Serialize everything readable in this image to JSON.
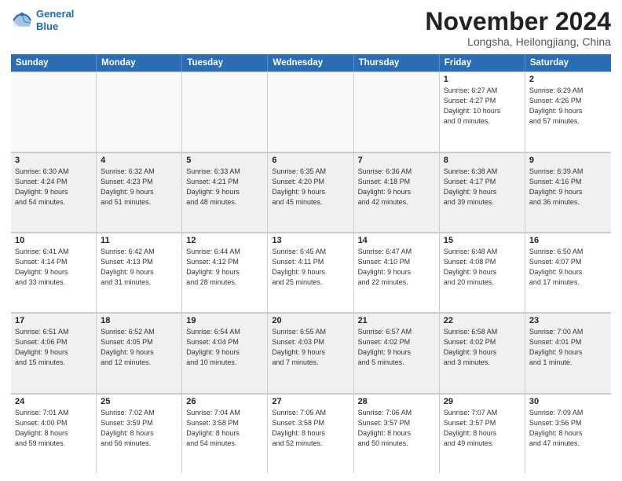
{
  "logo": {
    "line1": "General",
    "line2": "Blue"
  },
  "title": "November 2024",
  "subtitle": "Longsha, Heilongjiang, China",
  "header": {
    "days": [
      "Sunday",
      "Monday",
      "Tuesday",
      "Wednesday",
      "Thursday",
      "Friday",
      "Saturday"
    ]
  },
  "weeks": [
    [
      {
        "day": "",
        "info": ""
      },
      {
        "day": "",
        "info": ""
      },
      {
        "day": "",
        "info": ""
      },
      {
        "day": "",
        "info": ""
      },
      {
        "day": "",
        "info": ""
      },
      {
        "day": "1",
        "info": "Sunrise: 6:27 AM\nSunset: 4:27 PM\nDaylight: 10 hours\nand 0 minutes."
      },
      {
        "day": "2",
        "info": "Sunrise: 6:29 AM\nSunset: 4:26 PM\nDaylight: 9 hours\nand 57 minutes."
      }
    ],
    [
      {
        "day": "3",
        "info": "Sunrise: 6:30 AM\nSunset: 4:24 PM\nDaylight: 9 hours\nand 54 minutes."
      },
      {
        "day": "4",
        "info": "Sunrise: 6:32 AM\nSunset: 4:23 PM\nDaylight: 9 hours\nand 51 minutes."
      },
      {
        "day": "5",
        "info": "Sunrise: 6:33 AM\nSunset: 4:21 PM\nDaylight: 9 hours\nand 48 minutes."
      },
      {
        "day": "6",
        "info": "Sunrise: 6:35 AM\nSunset: 4:20 PM\nDaylight: 9 hours\nand 45 minutes."
      },
      {
        "day": "7",
        "info": "Sunrise: 6:36 AM\nSunset: 4:18 PM\nDaylight: 9 hours\nand 42 minutes."
      },
      {
        "day": "8",
        "info": "Sunrise: 6:38 AM\nSunset: 4:17 PM\nDaylight: 9 hours\nand 39 minutes."
      },
      {
        "day": "9",
        "info": "Sunrise: 6:39 AM\nSunset: 4:16 PM\nDaylight: 9 hours\nand 36 minutes."
      }
    ],
    [
      {
        "day": "10",
        "info": "Sunrise: 6:41 AM\nSunset: 4:14 PM\nDaylight: 9 hours\nand 33 minutes."
      },
      {
        "day": "11",
        "info": "Sunrise: 6:42 AM\nSunset: 4:13 PM\nDaylight: 9 hours\nand 31 minutes."
      },
      {
        "day": "12",
        "info": "Sunrise: 6:44 AM\nSunset: 4:12 PM\nDaylight: 9 hours\nand 28 minutes."
      },
      {
        "day": "13",
        "info": "Sunrise: 6:45 AM\nSunset: 4:11 PM\nDaylight: 9 hours\nand 25 minutes."
      },
      {
        "day": "14",
        "info": "Sunrise: 6:47 AM\nSunset: 4:10 PM\nDaylight: 9 hours\nand 22 minutes."
      },
      {
        "day": "15",
        "info": "Sunrise: 6:48 AM\nSunset: 4:08 PM\nDaylight: 9 hours\nand 20 minutes."
      },
      {
        "day": "16",
        "info": "Sunrise: 6:50 AM\nSunset: 4:07 PM\nDaylight: 9 hours\nand 17 minutes."
      }
    ],
    [
      {
        "day": "17",
        "info": "Sunrise: 6:51 AM\nSunset: 4:06 PM\nDaylight: 9 hours\nand 15 minutes."
      },
      {
        "day": "18",
        "info": "Sunrise: 6:52 AM\nSunset: 4:05 PM\nDaylight: 9 hours\nand 12 minutes."
      },
      {
        "day": "19",
        "info": "Sunrise: 6:54 AM\nSunset: 4:04 PM\nDaylight: 9 hours\nand 10 minutes."
      },
      {
        "day": "20",
        "info": "Sunrise: 6:55 AM\nSunset: 4:03 PM\nDaylight: 9 hours\nand 7 minutes."
      },
      {
        "day": "21",
        "info": "Sunrise: 6:57 AM\nSunset: 4:02 PM\nDaylight: 9 hours\nand 5 minutes."
      },
      {
        "day": "22",
        "info": "Sunrise: 6:58 AM\nSunset: 4:02 PM\nDaylight: 9 hours\nand 3 minutes."
      },
      {
        "day": "23",
        "info": "Sunrise: 7:00 AM\nSunset: 4:01 PM\nDaylight: 9 hours\nand 1 minute."
      }
    ],
    [
      {
        "day": "24",
        "info": "Sunrise: 7:01 AM\nSunset: 4:00 PM\nDaylight: 8 hours\nand 59 minutes."
      },
      {
        "day": "25",
        "info": "Sunrise: 7:02 AM\nSunset: 3:59 PM\nDaylight: 8 hours\nand 56 minutes."
      },
      {
        "day": "26",
        "info": "Sunrise: 7:04 AM\nSunset: 3:58 PM\nDaylight: 8 hours\nand 54 minutes."
      },
      {
        "day": "27",
        "info": "Sunrise: 7:05 AM\nSunset: 3:58 PM\nDaylight: 8 hours\nand 52 minutes."
      },
      {
        "day": "28",
        "info": "Sunrise: 7:06 AM\nSunset: 3:57 PM\nDaylight: 8 hours\nand 50 minutes."
      },
      {
        "day": "29",
        "info": "Sunrise: 7:07 AM\nSunset: 3:57 PM\nDaylight: 8 hours\nand 49 minutes."
      },
      {
        "day": "30",
        "info": "Sunrise: 7:09 AM\nSunset: 3:56 PM\nDaylight: 8 hours\nand 47 minutes."
      }
    ]
  ]
}
